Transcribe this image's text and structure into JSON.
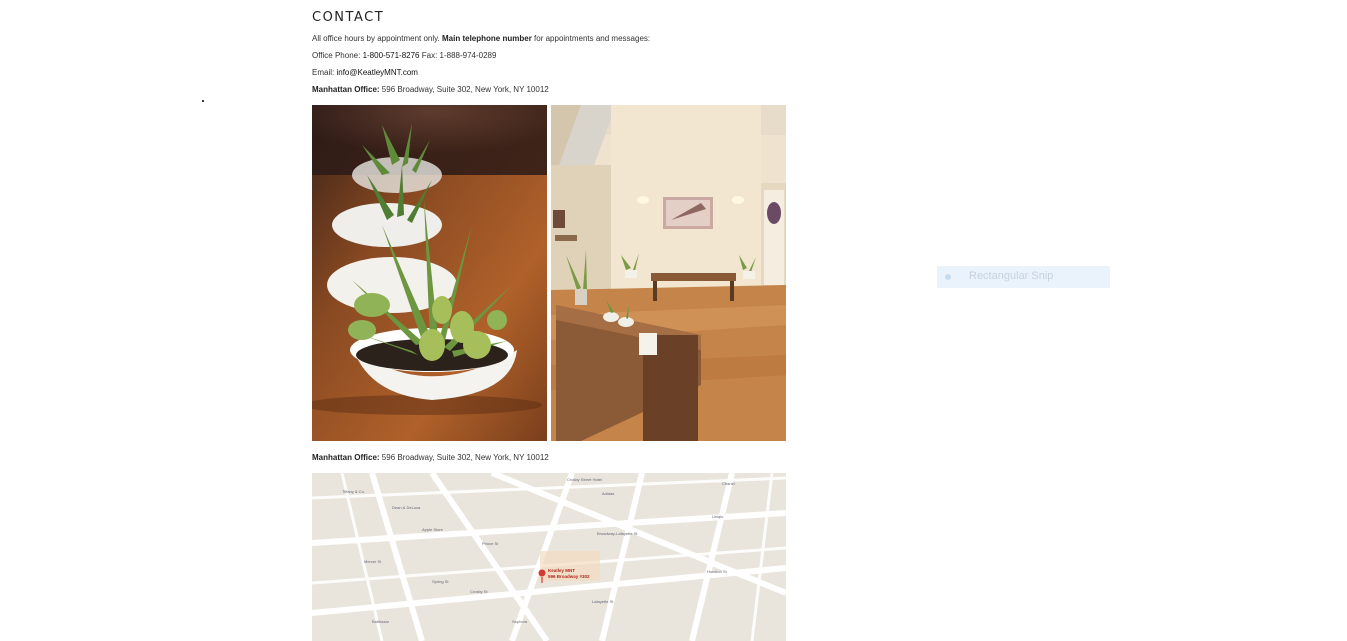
{
  "title": "CONTACT",
  "intro": {
    "pre": "All office hours by appointment only.",
    "bold": "Main telephone number",
    "post": "for appointments and messages:"
  },
  "phone": {
    "label": "Office Phone:",
    "number": "1-800-571-8276",
    "fax": "Fax: 1-888-974-0289"
  },
  "email": {
    "label": "Email:",
    "value": "info@KeatleyMNT.com"
  },
  "office_top": {
    "label": "Manhattan Office:",
    "address": "596 Broadway, Suite 302, New York, NY 10012"
  },
  "office_bottom": {
    "label": "Manhattan Office:",
    "address": "596 Broadway, Suite 302, New York, NY 10012"
  },
  "map": {
    "marker_line1": "Keatley MNT",
    "marker_line2": "596 Broadway #302",
    "labels": [
      "Tiffany & Co.",
      "Dean & DeLuca",
      "Adidas",
      "Chanel",
      "Crosby Street Hotel",
      "Broadway-Lafayette St",
      "Prince St",
      "Houston St",
      "Mercer St",
      "Crosby St",
      "Spring St",
      "Lafayette St",
      "Apple Store",
      "Balthazar",
      "Sephora",
      "Uniqlo"
    ]
  },
  "snip": {
    "label": "Rectangular Snip"
  }
}
